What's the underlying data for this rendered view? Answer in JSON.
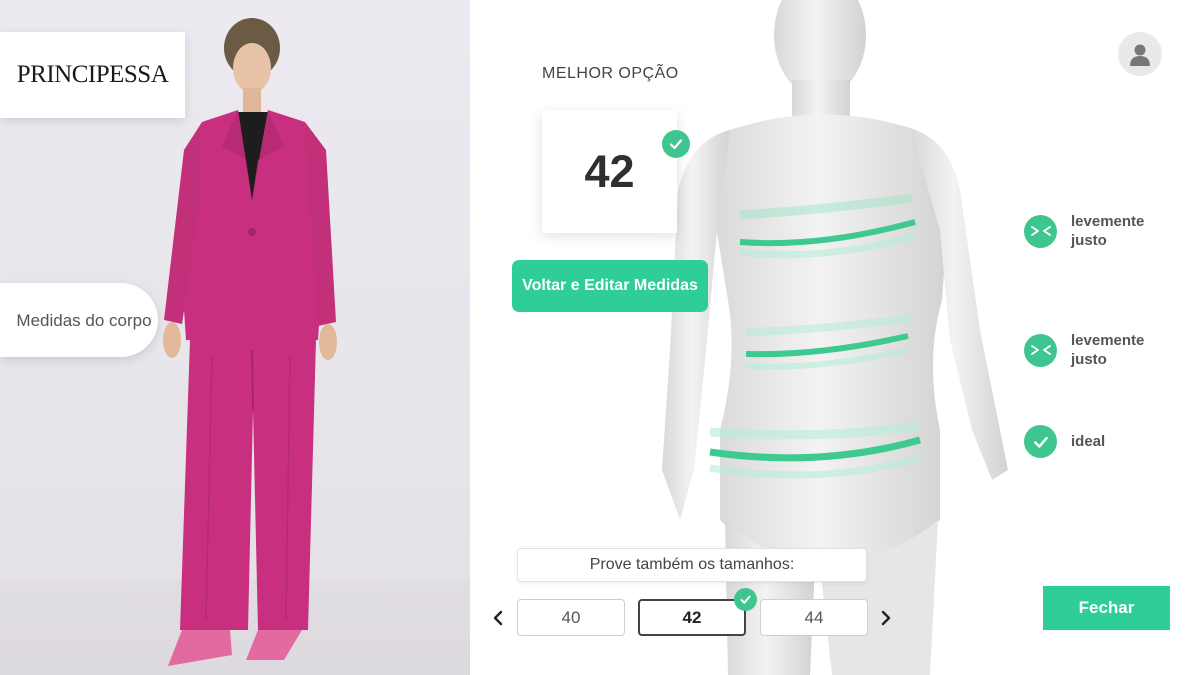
{
  "brand": {
    "name": "PRINCIPESSA"
  },
  "left_panel": {
    "body_measures_label": "Medidas do corpo"
  },
  "recommendation": {
    "label": "MELHOR OPÇÃO",
    "size": "42",
    "edit_button": "Voltar e Editar Medidas"
  },
  "fit_results": [
    {
      "label": "levemente justo",
      "icon": "tight-arrows-icon"
    },
    {
      "label": "levemente justo",
      "icon": "tight-arrows-icon"
    },
    {
      "label": "ideal",
      "icon": "check-icon"
    }
  ],
  "size_selector": {
    "prompt": "Prove também os tamanhos:",
    "sizes": [
      {
        "label": "40",
        "selected": false
      },
      {
        "label": "42",
        "selected": true
      },
      {
        "label": "44",
        "selected": false
      }
    ]
  },
  "close_button": "Fechar",
  "colors": {
    "accent_green": "#2fce97",
    "check_green": "#3fc58f",
    "suit_pink": "#c8307f"
  },
  "icons": {
    "profile": "user-avatar-icon",
    "prev": "chevron-left-icon",
    "next": "chevron-right-icon",
    "check": "check-icon"
  }
}
